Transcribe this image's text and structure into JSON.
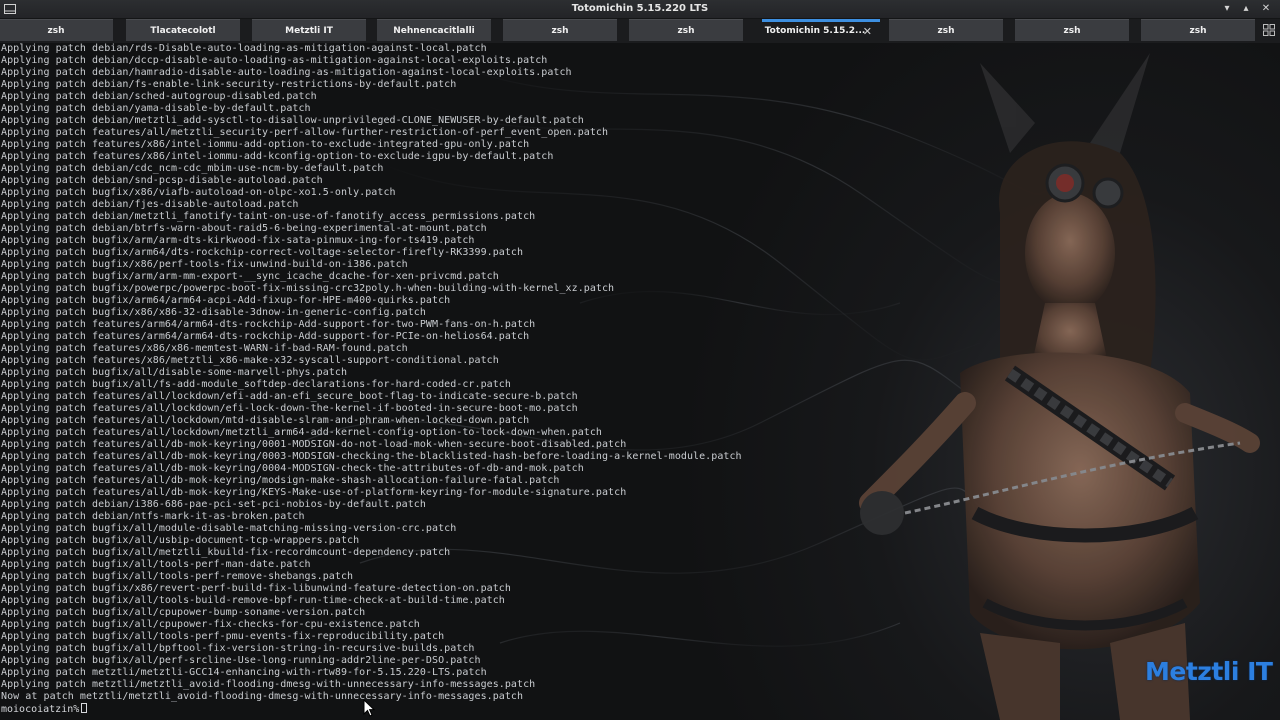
{
  "window": {
    "title": "Totomichin 5.15.220 LTS",
    "controls": {
      "minimize": "▾",
      "maximize": "▴",
      "close": "✕"
    }
  },
  "tabs": [
    {
      "label": "zsh",
      "active": false
    },
    {
      "label": "Tlacatecolotl",
      "active": false
    },
    {
      "label": "Metztli IT",
      "active": false
    },
    {
      "label": "Nehnencacitlalli",
      "active": false
    },
    {
      "label": "zsh",
      "active": false
    },
    {
      "label": "zsh",
      "active": false
    },
    {
      "label": "Totomichin 5.15.2...",
      "active": true
    },
    {
      "label": "zsh",
      "active": false
    },
    {
      "label": "zsh",
      "active": false
    },
    {
      "label": "zsh",
      "active": false
    }
  ],
  "terminal": {
    "lines": [
      "Applying patch debian/rds-Disable-auto-loading-as-mitigation-against-local.patch",
      "Applying patch debian/dccp-disable-auto-loading-as-mitigation-against-local-exploits.patch",
      "Applying patch debian/hamradio-disable-auto-loading-as-mitigation-against-local-exploits.patch",
      "Applying patch debian/fs-enable-link-security-restrictions-by-default.patch",
      "Applying patch debian/sched-autogroup-disabled.patch",
      "Applying patch debian/yama-disable-by-default.patch",
      "Applying patch debian/metztli_add-sysctl-to-disallow-unprivileged-CLONE_NEWUSER-by-default.patch",
      "Applying patch features/all/metztli_security-perf-allow-further-restriction-of-perf_event_open.patch",
      "Applying patch features/x86/intel-iommu-add-option-to-exclude-integrated-gpu-only.patch",
      "Applying patch features/x86/intel-iommu-add-kconfig-option-to-exclude-igpu-by-default.patch",
      "Applying patch debian/cdc_ncm-cdc_mbim-use-ncm-by-default.patch",
      "Applying patch debian/snd-pcsp-disable-autoload.patch",
      "Applying patch bugfix/x86/viafb-autoload-on-olpc-xo1.5-only.patch",
      "Applying patch debian/fjes-disable-autoload.patch",
      "Applying patch debian/metztli_fanotify-taint-on-use-of-fanotify_access_permissions.patch",
      "Applying patch debian/btrfs-warn-about-raid5-6-being-experimental-at-mount.patch",
      "Applying patch bugfix/arm/arm-dts-kirkwood-fix-sata-pinmux-ing-for-ts419.patch",
      "Applying patch bugfix/arm64/dts-rockchip-correct-voltage-selector-firefly-RK3399.patch",
      "Applying patch bugfix/x86/perf-tools-fix-unwind-build-on-i386.patch",
      "Applying patch bugfix/arm/arm-mm-export-__sync_icache_dcache-for-xen-privcmd.patch",
      "Applying patch bugfix/powerpc/powerpc-boot-fix-missing-crc32poly.h-when-building-with-kernel_xz.patch",
      "Applying patch bugfix/arm64/arm64-acpi-Add-fixup-for-HPE-m400-quirks.patch",
      "Applying patch bugfix/x86/x86-32-disable-3dnow-in-generic-config.patch",
      "Applying patch features/arm64/arm64-dts-rockchip-Add-support-for-two-PWM-fans-on-h.patch",
      "Applying patch features/arm64/arm64-dts-rockchip-Add-support-for-PCIe-on-helios64.patch",
      "Applying patch features/x86/x86-memtest-WARN-if-bad-RAM-found.patch",
      "Applying patch features/x86/metztli_x86-make-x32-syscall-support-conditional.patch",
      "Applying patch bugfix/all/disable-some-marvell-phys.patch",
      "Applying patch bugfix/all/fs-add-module_softdep-declarations-for-hard-coded-cr.patch",
      "Applying patch features/all/lockdown/efi-add-an-efi_secure_boot-flag-to-indicate-secure-b.patch",
      "Applying patch features/all/lockdown/efi-lock-down-the-kernel-if-booted-in-secure-boot-mo.patch",
      "Applying patch features/all/lockdown/mtd-disable-slram-and-phram-when-locked-down.patch",
      "Applying patch features/all/lockdown/metztli_arm64-add-kernel-config-option-to-lock-down-when.patch",
      "Applying patch features/all/db-mok-keyring/0001-MODSIGN-do-not-load-mok-when-secure-boot-disabled.patch",
      "Applying patch features/all/db-mok-keyring/0003-MODSIGN-checking-the-blacklisted-hash-before-loading-a-kernel-module.patch",
      "Applying patch features/all/db-mok-keyring/0004-MODSIGN-check-the-attributes-of-db-and-mok.patch",
      "Applying patch features/all/db-mok-keyring/modsign-make-shash-allocation-failure-fatal.patch",
      "Applying patch features/all/db-mok-keyring/KEYS-Make-use-of-platform-keyring-for-module-signature.patch",
      "Applying patch debian/i386-686-pae-pci-set-pci-nobios-by-default.patch",
      "Applying patch debian/ntfs-mark-it-as-broken.patch",
      "Applying patch bugfix/all/module-disable-matching-missing-version-crc.patch",
      "Applying patch bugfix/all/usbip-document-tcp-wrappers.patch",
      "Applying patch bugfix/all/metztli_kbuild-fix-recordmcount-dependency.patch",
      "Applying patch bugfix/all/tools-perf-man-date.patch",
      "Applying patch bugfix/all/tools-perf-remove-shebangs.patch",
      "Applying patch bugfix/x86/revert-perf-build-fix-libunwind-feature-detection-on.patch",
      "Applying patch bugfix/all/tools-build-remove-bpf-run-time-check-at-build-time.patch",
      "Applying patch bugfix/all/cpupower-bump-soname-version.patch",
      "Applying patch bugfix/all/cpupower-fix-checks-for-cpu-existence.patch",
      "Applying patch bugfix/all/tools-perf-pmu-events-fix-reproducibility.patch",
      "Applying patch bugfix/all/bpftool-fix-version-string-in-recursive-builds.patch",
      "Applying patch bugfix/all/perf-srcline-Use-long-running-addr2line-per-DSO.patch",
      "Applying patch metztli/metztli-GCC14-enhancing-with-rtw89-for-5.15.220-LTS.patch",
      "Applying patch metztli/metztli_avoid-flooding-dmesg-with-unnecessary-info-messages.patch",
      "Now at patch metztli/metztli_avoid-flooding-dmesg-with-unnecessary-info-messages.patch"
    ],
    "prompt": "moiocoiatzin%"
  },
  "watermark": "Metztli IT",
  "colors": {
    "accent": "#3d8fe0",
    "watermark": "#2c7fe0",
    "terminal_text": "#c9ccd0",
    "tab_bg": "#3a3c40"
  },
  "icons": {
    "app": "terminal-icon",
    "tab_menu": "grid-icon",
    "tab_close": "close-icon",
    "pointer": "mouse-pointer-icon"
  }
}
